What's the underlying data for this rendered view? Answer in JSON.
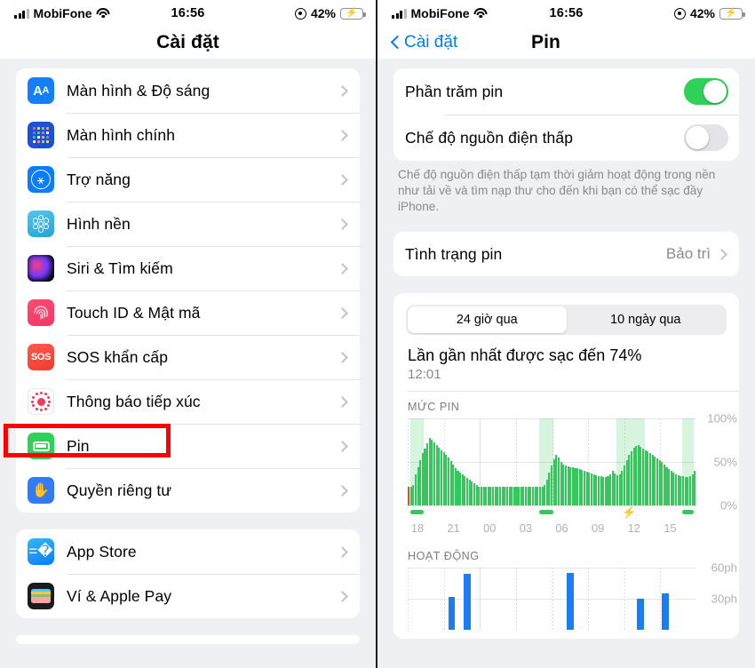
{
  "left": {
    "statusbar": {
      "carrier": "MobiFone",
      "time": "16:56",
      "battery_pct": "42%",
      "wifi_icon": "wifi-icon",
      "signal_icon": "signal-bars-icon",
      "location_icon": "location-services-icon",
      "battery_icon": "battery-charging-icon"
    },
    "nav": {
      "title": "Cài đặt"
    },
    "group1": [
      {
        "label": "Màn hình & Độ sáng",
        "icon": "display-brightness-icon"
      },
      {
        "label": "Màn hình chính",
        "icon": "home-screen-icon"
      },
      {
        "label": "Trợ năng",
        "icon": "accessibility-icon"
      },
      {
        "label": "Hình nền",
        "icon": "wallpaper-icon"
      },
      {
        "label": "Siri & Tìm kiếm",
        "icon": "siri-icon"
      },
      {
        "label": "Touch ID & Mật mã",
        "icon": "touch-id-icon"
      },
      {
        "label": "SOS khẩn cấp",
        "icon": "emergency-sos-icon"
      },
      {
        "label": "Thông báo tiếp xúc",
        "icon": "exposure-notifications-icon"
      },
      {
        "label": "Pin",
        "icon": "battery-icon"
      },
      {
        "label": "Quyền riêng tư",
        "icon": "privacy-hand-icon"
      }
    ],
    "group2": [
      {
        "label": "App Store",
        "icon": "app-store-icon"
      },
      {
        "label": "Ví & Apple Pay",
        "icon": "wallet-icon"
      }
    ]
  },
  "right": {
    "statusbar": {
      "carrier": "MobiFone",
      "time": "16:56",
      "battery_pct": "42%"
    },
    "nav": {
      "back_label": "Cài đặt",
      "title": "Pin"
    },
    "toggles": [
      {
        "label": "Phần trăm pin",
        "state": "on"
      },
      {
        "label": "Chế độ nguồn điện thấp",
        "state": "off"
      }
    ],
    "note": "Chế độ nguồn điện thấp tạm thời giảm hoạt động trong nền như tải về và tìm nạp thư cho đến khi bạn có thể sạc đầy iPhone.",
    "health_row": {
      "label": "Tình trạng pin",
      "value": "Bảo trì"
    },
    "segmented": {
      "options": [
        "24 giờ qua",
        "10 ngày qua"
      ],
      "selected": "24 giờ qua"
    },
    "last_charge": {
      "title": "Lần gần nhất được sạc đến 74%",
      "time": "12:01"
    },
    "battery_section_label": "MỨC PIN",
    "activity_section_label": "HOẠT ĐỘNG",
    "accent_green": "#34c759",
    "accent_blue": "#1a7ef0",
    "accent_red": "#ff3b30",
    "highlight_color": "#ff0000"
  },
  "chart_data": [
    {
      "type": "bar",
      "title": "MỨC PIN",
      "xlabel": "",
      "ylabel": "",
      "ylim": [
        0,
        100
      ],
      "ytick_labels": [
        "100%",
        "50%",
        "0%"
      ],
      "ytick_values": [
        100,
        50,
        0
      ],
      "xtick_labels": [
        "18",
        "21",
        "00",
        "03",
        "06",
        "09",
        "12",
        "15"
      ],
      "grid": true,
      "legend": "none",
      "bar_color": "#34c759",
      "highlight_bar_color": "#ff3b30",
      "charging_shade_color": "rgba(52,199,89,0.20)",
      "values": [
        22,
        22,
        24,
        36,
        44,
        52,
        60,
        66,
        72,
        78,
        76,
        73,
        70,
        67,
        64,
        61,
        58,
        55,
        51,
        47,
        43,
        40,
        38,
        36,
        34,
        32,
        30,
        28,
        26,
        24,
        22,
        22,
        22,
        22,
        22,
        22,
        22,
        22,
        22,
        22,
        22,
        22,
        22,
        22,
        22,
        22,
        22,
        22,
        22,
        22,
        22,
        22,
        22,
        22,
        22,
        22,
        22,
        22,
        24,
        30,
        38,
        46,
        53,
        58,
        55,
        50,
        47,
        46,
        45,
        44,
        44,
        43,
        43,
        42,
        41,
        40,
        39,
        38,
        37,
        36,
        35,
        34,
        34,
        33,
        33,
        34,
        36,
        40,
        37,
        35,
        36,
        40,
        46,
        52,
        58,
        63,
        67,
        69,
        70,
        68,
        66,
        64,
        62,
        60,
        58,
        56,
        54,
        52,
        50,
        47,
        44,
        42,
        40,
        38,
        36,
        35,
        34,
        34,
        33,
        33,
        34,
        36,
        40
      ],
      "first_bar_is_red": true,
      "charging_periods": [
        {
          "start_index": 1,
          "end_index": 7
        },
        {
          "start_index": 56,
          "end_index": 62
        },
        {
          "start_index": 89,
          "end_index": 101
        },
        {
          "start_index": 117,
          "end_index": 122
        }
      ]
    },
    {
      "type": "bar",
      "title": "HOẠT ĐỘNG",
      "xlabel": "",
      "ylabel": "",
      "ylim": [
        0,
        60
      ],
      "ytick_labels": [
        "60ph",
        "30ph"
      ],
      "ytick_values": [
        60,
        30
      ],
      "xtick_labels": [
        "18",
        "21",
        "00",
        "03",
        "06",
        "09",
        "12",
        "15"
      ],
      "grid": true,
      "bar_color": "#1a7ef0",
      "points": [
        {
          "x_pct": 14.0,
          "value": 32
        },
        {
          "x_pct": 19.5,
          "value": 54
        },
        {
          "x_pct": 55.0,
          "value": 55
        },
        {
          "x_pct": 79.5,
          "value": 30
        },
        {
          "x_pct": 88.0,
          "value": 35
        }
      ]
    }
  ]
}
